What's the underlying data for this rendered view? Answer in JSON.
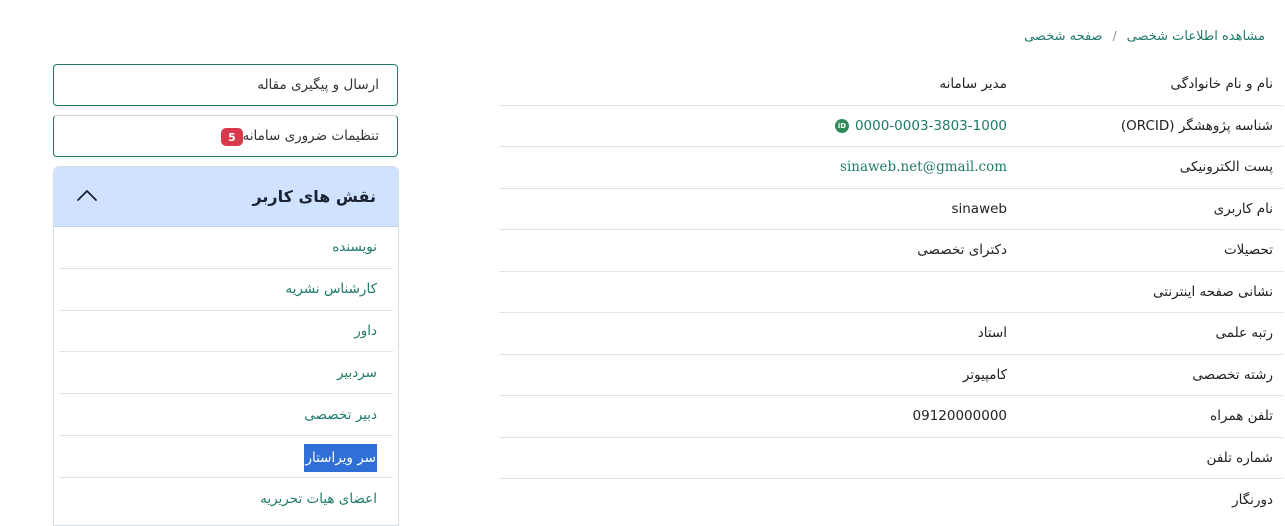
{
  "breadcrumb": {
    "home": "صفحه شخصی",
    "separator": "/",
    "current": "مشاهده اطلاعات شخصی"
  },
  "profile": {
    "rows": [
      {
        "label": "نام و نام خانوادگی",
        "value": "مدیر سامانه"
      },
      {
        "label": "شناسه پژوهشگر (ORCID)",
        "value": "0000-0003-3803-1000",
        "icon": "orcid-icon"
      },
      {
        "label": "پست الکترونیکی",
        "value": "sinaweb.net@gmail.com"
      },
      {
        "label": "نام کاربری",
        "value": "sinaweb"
      },
      {
        "label": "تحصیلات",
        "value": "دکترای تخصصی"
      },
      {
        "label": "نشانی صفحه اینترنتی",
        "value": ""
      },
      {
        "label": "رتبه علمی",
        "value": "استاد"
      },
      {
        "label": "رشته تخصصی",
        "value": "کامپیوتر"
      },
      {
        "label": "تلفن همراه",
        "value": "09120000000"
      },
      {
        "label": "شماره تلفن",
        "value": ""
      },
      {
        "label": "دورنگار",
        "value": ""
      }
    ]
  },
  "sidebar": {
    "submit_article": "ارسال و پیگیری مقاله",
    "settings": {
      "label": "تنظیمات ضروری سامانه",
      "badge": "5"
    },
    "roles": {
      "title": "نقش های کاربر",
      "items": [
        {
          "label": "نویسنده"
        },
        {
          "label": "کارشناس نشریه"
        },
        {
          "label": "داور"
        },
        {
          "label": "سردبیر"
        },
        {
          "label": "دبیر تخصصی"
        },
        {
          "label": "سر ویراستار",
          "active": true
        },
        {
          "label": "اعضای هیات تحریریه"
        }
      ]
    }
  },
  "colors": {
    "accent": "#1f7a6a",
    "badge": "#d9394a",
    "roles_header": "#cfe2ff",
    "active_highlight": "#2f6fd6"
  }
}
